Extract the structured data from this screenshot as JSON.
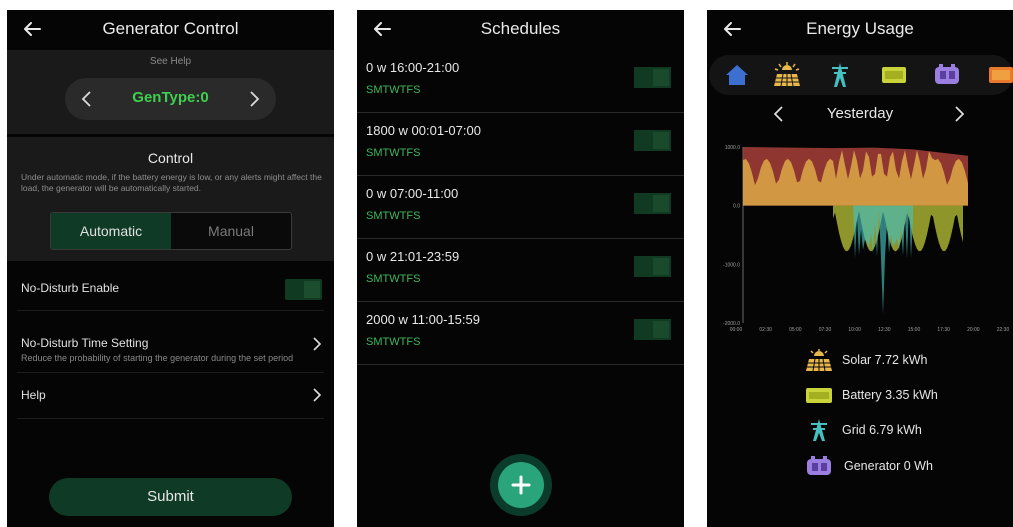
{
  "colors": {
    "accent_green": "#3fcf4e",
    "toggle_green": "#113a22",
    "solar": "#e8b84a",
    "battery": "#c9d33a",
    "grid": "#46c0c0",
    "generator": "#9a7ee0",
    "fab": "#2aa57b"
  },
  "generator_control": {
    "title": "Generator Control",
    "see_help": "See Help",
    "gen_type": "GenType:0",
    "control_title": "Control",
    "control_desc": "Under automatic mode, if the battery energy is low, or any alerts might affect the load, the generator will be automatically started.",
    "mode_options": [
      "Automatic",
      "Manual"
    ],
    "mode_selected": "Automatic",
    "no_disturb_label": "No-Disturb Enable",
    "no_disturb_time_label": "No-Disturb Time Setting",
    "no_disturb_time_desc": "Reduce the probability of starting the generator during the set period",
    "help_label": "Help",
    "submit_label": "Submit"
  },
  "schedules": {
    "title": "Schedules",
    "items": [
      {
        "time": "0 w  16:00-21:00",
        "days": "SMTWTFS"
      },
      {
        "time": "1800 w  00:01-07:00",
        "days": "SMTWTFS"
      },
      {
        "time": "0 w  07:00-11:00",
        "days": "SMTWTFS"
      },
      {
        "time": "0 w  21:01-23:59",
        "days": "SMTWTFS"
      },
      {
        "time": "2000 w  11:00-15:59",
        "days": "SMTWTFS"
      }
    ],
    "add_icon": "plus-icon"
  },
  "energy_usage": {
    "title": "Energy Usage",
    "icons": [
      "home-icon",
      "solar-panel-icon",
      "grid-tower-icon",
      "battery-icon",
      "generator-icon",
      "battery-full-icon"
    ],
    "date_label": "Yesterday",
    "legend": [
      {
        "icon": "solar-panel-icon",
        "label": "Solar  7.72 kWh"
      },
      {
        "icon": "battery-icon",
        "label": "Battery  3.35 kWh"
      },
      {
        "icon": "grid-tower-icon",
        "label": "Grid  6.79 kWh"
      },
      {
        "icon": "generator-icon",
        "label": "Generator  0 Wh"
      }
    ]
  },
  "chart_data": {
    "type": "area",
    "y_ticks": [
      "1000.0",
      "0.0",
      "-1000.0",
      "-2000.0"
    ],
    "x_ticks": [
      "00:00",
      "02:30",
      "05:00",
      "07:30",
      "10:00",
      "12:30",
      "15:00",
      "17:30",
      "20:00",
      "22:30"
    ],
    "ylim": [
      -2000,
      1000
    ],
    "series": [
      {
        "name": "Solar",
        "color": "#e8b84a"
      },
      {
        "name": "Battery",
        "color": "#c9d33a"
      },
      {
        "name": "Grid",
        "color": "#46c0c0"
      },
      {
        "name": "Generator",
        "color": "#9a7ee0"
      }
    ]
  }
}
